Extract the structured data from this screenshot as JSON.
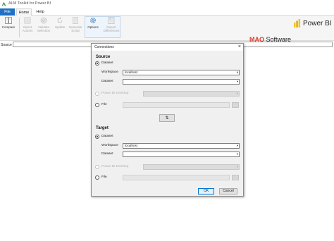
{
  "window": {
    "title": "ALM Toolkit for Power BI"
  },
  "menu": {
    "file": "File",
    "home": "Home",
    "help": "Help"
  },
  "ribbon": {
    "compare": "Compare",
    "select_actions": "Select Actions",
    "validate_selection": "Validate Selection",
    "update": "Update",
    "generate_script": "Generate Script",
    "options": "Options",
    "report_differences": "Report Differences"
  },
  "brand": {
    "maq_bold": "MAQ",
    "maq_rest": "Software",
    "powerbi": "Power BI"
  },
  "main": {
    "source_label": "Source"
  },
  "dialog": {
    "title": "Connections",
    "close": "×",
    "source": {
      "heading": "Source",
      "dataset_radio": "Dataset",
      "workspace_label": "Workspace",
      "workspace_value": "localhost",
      "dataset_label": "Dataset",
      "dataset_value": "",
      "pbi_desktop_radio": "Power BI Desktop",
      "file_radio": "File"
    },
    "swap": "⇅",
    "target": {
      "heading": "Target",
      "dataset_radio": "Dataset",
      "workspace_label": "Workspace",
      "workspace_value": "localhost",
      "dataset_label": "Dataset",
      "dataset_value": "",
      "pbi_desktop_radio": "Power BI Desktop",
      "file_radio": "File"
    },
    "ok": "OK",
    "cancel": "Cancel"
  },
  "icons": {
    "app": "alm-app-icon",
    "compare": "compare-icon",
    "select_actions": "select-actions-icon",
    "validate": "validate-icon",
    "update": "update-icon",
    "generate_script": "generate-script-icon",
    "options": "gear-icon",
    "report": "report-icon",
    "powerbi": "powerbi-logo-icon"
  },
  "colors": {
    "accent": "#1e6fc5",
    "brand_red": "#e03a2f",
    "powerbi_yellow": "#f2c811"
  }
}
